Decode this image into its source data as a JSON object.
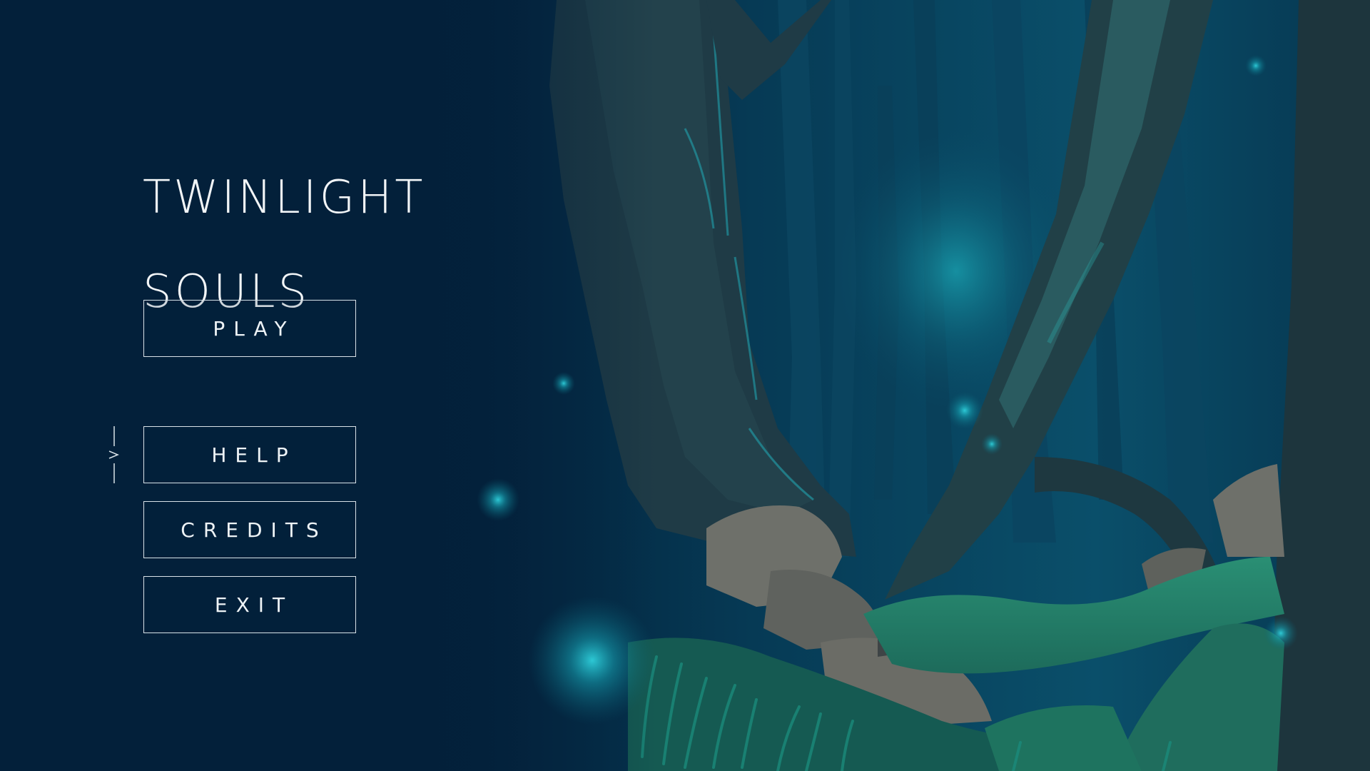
{
  "game": {
    "title_line_1": "TWINLIGHT",
    "title_line_2": "SOULS"
  },
  "menu": {
    "items": [
      {
        "id": "play",
        "label": "PLAY",
        "selected": false
      },
      {
        "id": "help",
        "label": "HELP",
        "selected": true
      },
      {
        "id": "credits",
        "label": "CREDITS",
        "selected": false
      },
      {
        "id": "exit",
        "label": "EXIT",
        "selected": false
      }
    ],
    "cursor_icon": "selection-arrow-icon"
  },
  "theme": {
    "background": "#03203a",
    "text": "#f2f5f7",
    "button_border": "#d9e2e8",
    "firefly_glow": "#1fb6c4",
    "moss": "#2e8f73"
  }
}
